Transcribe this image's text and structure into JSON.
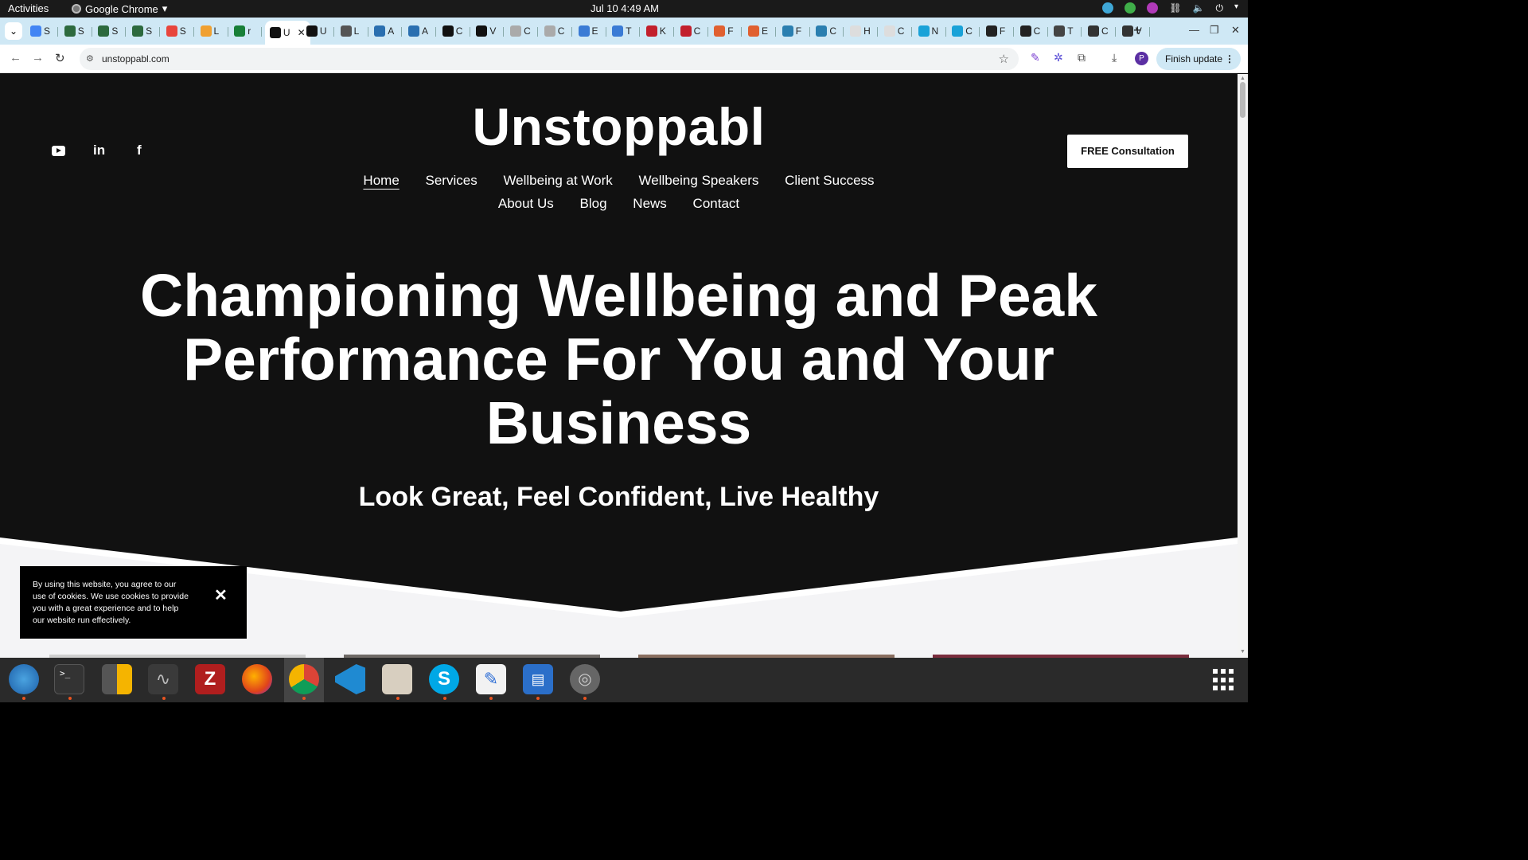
{
  "system": {
    "activities": "Activities",
    "app_name": "Google Chrome",
    "clock": "Jul 10  4:49 AM"
  },
  "browser": {
    "tabs": [
      "S",
      "S",
      "S",
      "S",
      "S",
      "L",
      "r",
      "U",
      "U",
      "L",
      "A",
      "A",
      "C",
      "V",
      "C",
      "C",
      "E",
      "T",
      "K",
      "C",
      "F",
      "E",
      "F",
      "C",
      "H",
      "C",
      "N",
      "C",
      "F",
      "C",
      "T",
      "C",
      "V"
    ],
    "active_tab_label": "U",
    "url": "unstoppabl.com",
    "profile_initial": "P",
    "finish_update": "Finish update"
  },
  "page": {
    "logo": "Unstoppabl",
    "cta": "FREE Consultation",
    "nav_row1": [
      "Home",
      "Services",
      "Wellbeing at Work",
      "Wellbeing Speakers",
      "Client Success"
    ],
    "nav_row2": [
      "About Us",
      "Blog",
      "News",
      "Contact"
    ],
    "hero_line1": "Championing Wellbeing and Peak",
    "hero_line2": "Performance For You and Your",
    "hero_line3": "Business",
    "tagline": "Look Great, Feel Confident, Live Healthy",
    "cookie_text": "By using this website, you agree to our use of cookies. We use cookies to provide you with a great experience and to help our website run effectively.",
    "cookie_close": "✕",
    "social": [
      "youtube-icon",
      "linkedin-icon",
      "facebook-icon"
    ],
    "social_glyphs": {
      "linkedin": "in",
      "facebook": "f"
    }
  },
  "colors": {
    "page_bg": "#111111",
    "tab_strip": "#cfe8f5",
    "accent_update": "#cfe8f5",
    "dock_bg": "#2a2a2a",
    "dock_indicator": "#e95420"
  }
}
